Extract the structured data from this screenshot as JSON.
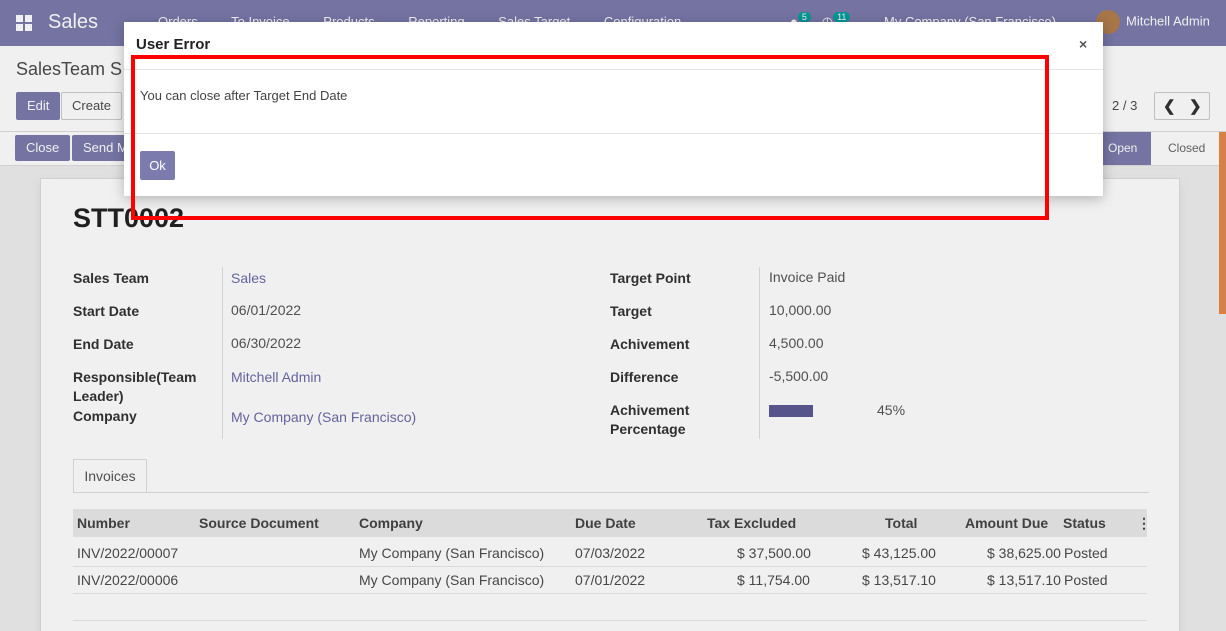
{
  "navbar": {
    "app_name": "Sales",
    "menu": [
      "Orders",
      "To Invoice",
      "Products",
      "Reporting",
      "Sales Target",
      "Configuration"
    ],
    "messages_count": "5",
    "activities_count": "11",
    "company": "My Company (San Francisco)",
    "user": "Mitchell Admin"
  },
  "control_panel": {
    "breadcrumb": "SalesTeam S",
    "edit_label": "Edit",
    "create_label": "Create",
    "pager": "2 / 3",
    "prev_icon": "chevron-left-icon",
    "next_icon": "chevron-right-icon"
  },
  "statusbar": {
    "close_label": "Close",
    "send_label": "Send M",
    "stages": [
      "Open",
      "Closed"
    ],
    "active_stage": "Open"
  },
  "record": {
    "name": "STT0002",
    "left_fields": [
      {
        "label": "Sales Team",
        "value": "Sales"
      },
      {
        "label": "Start Date",
        "value": "06/01/2022"
      },
      {
        "label": "End Date",
        "value": "06/30/2022"
      },
      {
        "label": "Responsible(Team Leader)",
        "value": "Mitchell Admin"
      },
      {
        "label": "Company",
        "value": "My Company (San Francisco)"
      }
    ],
    "right_fields": [
      {
        "label": "Target Point",
        "value": "Invoice Paid"
      },
      {
        "label": "Target",
        "value": "10,000.00"
      },
      {
        "label": "Achivement",
        "value": "4,500.00"
      },
      {
        "label": "Difference",
        "value": "-5,500.00"
      },
      {
        "label": "Achivement Percentage",
        "value": "45%"
      }
    ],
    "achievement_progress": 0.45
  },
  "invoices_tab": {
    "tab_label": "Invoices",
    "columns": [
      "Number",
      "Source Document",
      "Company",
      "Due Date",
      "Tax Excluded",
      "Total",
      "Amount Due",
      "Status"
    ],
    "rows": [
      [
        "INV/2022/00007",
        "",
        "My Company (San Francisco)",
        "07/03/2022",
        "$ 37,500.00",
        "$ 43,125.00",
        "$ 38,625.00",
        "Posted"
      ],
      [
        "INV/2022/00006",
        "",
        "My Company (San Francisco)",
        "07/01/2022",
        "$ 11,754.00",
        "$ 13,517.10",
        "$ 13,517.10",
        "Posted"
      ]
    ]
  },
  "dialog": {
    "title": "User Error",
    "close_symbol": "×",
    "message": "You can close after Target End Date",
    "ok_label": "Ok"
  },
  "colors": {
    "brand": "#7c7bad",
    "annotation": "#ff0000"
  }
}
